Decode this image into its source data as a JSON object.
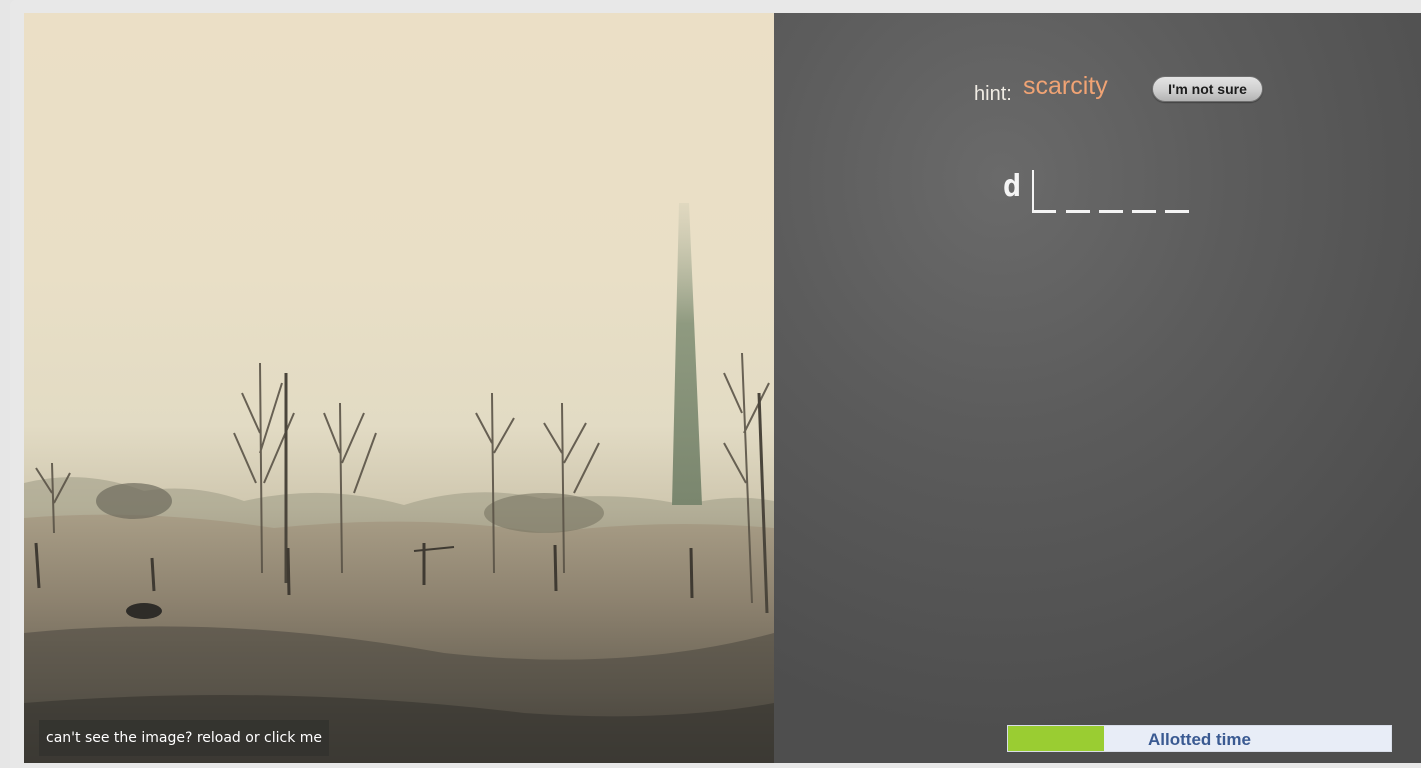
{
  "image": {
    "caption": "can't see the image? reload or click me"
  },
  "hint": {
    "label": "hint:",
    "word": "scarcity"
  },
  "buttons": {
    "not_sure": "I'm not sure"
  },
  "answer": {
    "revealed_letter": "d",
    "blank_count": 5
  },
  "timer": {
    "label": "Allotted time",
    "elapsed_fraction": 0.25,
    "fill_color": "#9acd32"
  },
  "colors": {
    "hint_word": "#f0a374",
    "timer_text": "#3a5a92"
  }
}
